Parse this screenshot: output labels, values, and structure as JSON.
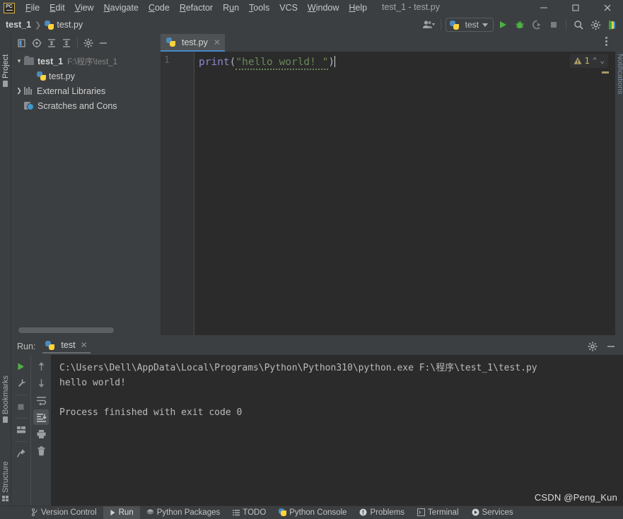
{
  "window": {
    "title": "test_1 - test.py",
    "logo_text": "PC",
    "minimize": "—",
    "maximize": "□",
    "close": "✕"
  },
  "menubar": {
    "items": [
      {
        "label": "File"
      },
      {
        "label": "Edit"
      },
      {
        "label": "View"
      },
      {
        "label": "Navigate"
      },
      {
        "label": "Code"
      },
      {
        "label": "Refactor"
      },
      {
        "label": "Run"
      },
      {
        "label": "Tools"
      },
      {
        "label": "VCS"
      },
      {
        "label": "Window"
      },
      {
        "label": "Help"
      }
    ]
  },
  "navbar": {
    "breadcrumb": {
      "project": "test_1",
      "separator": "❯",
      "file": "test.py"
    },
    "toolbar": {
      "user_icon": "user-profile-icon",
      "run_config_name": "test",
      "run_label": "Run",
      "debug_label": "Debug",
      "coverage_label": "Run with Coverage",
      "stop_label": "Stop",
      "search_label": "Search Everywhere",
      "settings_label": "Settings"
    }
  },
  "left_strip": {
    "project_label": "Project",
    "bookmarks_label": "Bookmarks",
    "structure_label": "Structure"
  },
  "right_strip": {
    "notifications_label": "Notifications"
  },
  "project_panel": {
    "toolbar_icons": [
      "select-opened-file-icon",
      "scroll-from-source-icon",
      "expand-all-icon",
      "collapse-all-icon",
      "settings-gear-icon",
      "hide-icon"
    ],
    "tree": [
      {
        "label": "test_1",
        "path": "F:\\程序\\test_1",
        "icon": "folder-icon",
        "arrow": "▾",
        "depth": 0,
        "bold": true
      },
      {
        "label": "test.py",
        "path": "",
        "icon": "python-file-icon",
        "arrow": "",
        "depth": 1,
        "bold": false
      },
      {
        "label": "External Libraries",
        "path": "",
        "icon": "libraries-icon",
        "arrow": "❯",
        "depth": 0,
        "bold": false
      },
      {
        "label": "Scratches and Cons",
        "path": "",
        "icon": "scratches-icon",
        "arrow": "",
        "depth": 0,
        "bold": false
      }
    ]
  },
  "editor": {
    "tabs": [
      {
        "label": "test.py",
        "icon": "python-file-icon",
        "close": "✕",
        "active": true
      }
    ],
    "kebab_label": "more-tabs-options",
    "line_numbers": [
      "1"
    ],
    "code": {
      "fn": "print",
      "open_paren": "(",
      "string": "\"hello world! \"",
      "close_paren": ")"
    },
    "inspection": {
      "icon": "warning-triangle-icon",
      "count": "1",
      "prev": "⌃",
      "next": "⌄"
    }
  },
  "run_panel": {
    "header_label": "Run:",
    "tab_label": "test",
    "tab_close": "✕",
    "settings_icon": "gear-icon",
    "hide_icon": "minimize-icon",
    "gutter_left": [
      "rerun-icon",
      "configure-icon",
      "stop-icon",
      "layout-icon",
      "pin-tab-icon"
    ],
    "gutter_right": [
      "up-arrow-icon",
      "down-arrow-icon",
      "soft-wrap-icon",
      "scroll-to-end-icon",
      "print-icon",
      "clear-all-icon"
    ],
    "console_lines": [
      "C:\\Users\\Dell\\AppData\\Local\\Programs\\Python\\Python310\\python.exe F:\\程序\\test_1\\test.py",
      "hello world!",
      "",
      "Process finished with exit code 0"
    ]
  },
  "statusbar": {
    "items": [
      {
        "label": "Version Control",
        "icon": "branch-icon",
        "active": false
      },
      {
        "label": "Run",
        "icon": "play-icon",
        "active": true
      },
      {
        "label": "Python Packages",
        "icon": "packages-icon",
        "active": false
      },
      {
        "label": "TODO",
        "icon": "list-icon",
        "active": false
      },
      {
        "label": "Python Console",
        "icon": "python-icon",
        "active": false
      },
      {
        "label": "Problems",
        "icon": "error-icon",
        "active": false
      },
      {
        "label": "Terminal",
        "icon": "terminal-icon",
        "active": false
      },
      {
        "label": "Services",
        "icon": "services-icon",
        "active": false
      }
    ]
  },
  "watermark": "CSDN @Peng_Kun",
  "colors": {
    "background": "#3c3f41",
    "editor_background": "#2b2b2b",
    "accent_tab": "#4a88c7",
    "run_green": "#5a9e4b",
    "string_green": "#6a8759",
    "keyword_purple": "#8a87cd",
    "warning_yellow": "#c8b560"
  }
}
